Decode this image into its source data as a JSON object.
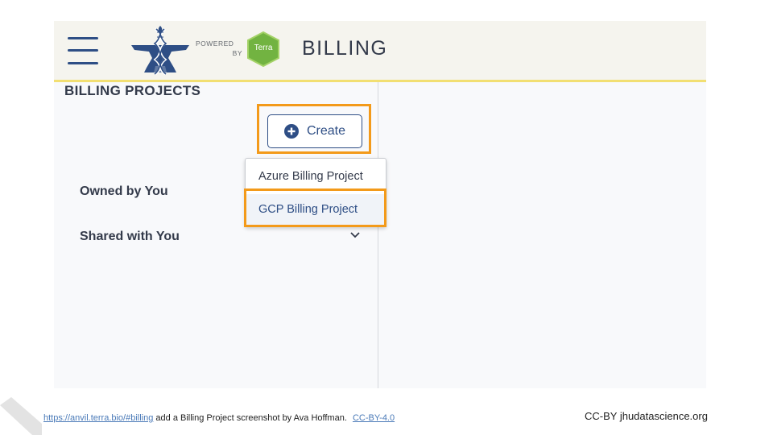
{
  "header": {
    "title": "BILLING",
    "powered_line1": "POWERED",
    "powered_line2": "BY",
    "terra_logo_text": "Terra",
    "menu_icon": "hamburger-menu-icon",
    "anvil_logo_icon": "anvil-logo-icon"
  },
  "sidebar": {
    "title": "BILLING PROJECTS",
    "create_label": "Create",
    "create_icon": "plus-circle-icon",
    "dropdown_items": [
      {
        "label": "Azure Billing Project"
      },
      {
        "label": "GCP Billing Project"
      }
    ],
    "nav": {
      "owned": "Owned by You",
      "shared": "Shared with You",
      "expand_icon": "chevron-down-icon"
    }
  },
  "footer": {
    "link_text": "https://anvil.terra.bio/#billing",
    "caption_text": "add a Billing Project screenshot by Ava Hoffman.",
    "license_text": "CC-BY-4.0",
    "credit": "CC-BY  jhudatascience.org"
  },
  "colors": {
    "brand_blue": "#2e4e85",
    "highlight_orange": "#f39a1a",
    "header_bg": "#f5f4ee",
    "header_border": "#f2df72",
    "terra_green": "#72b341"
  }
}
